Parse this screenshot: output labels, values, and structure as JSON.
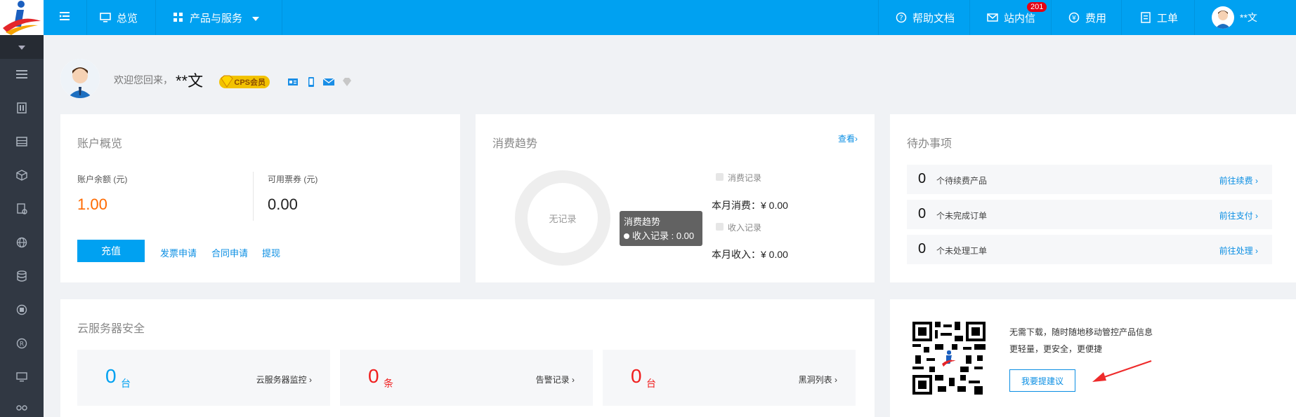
{
  "colors": {
    "brand_blue": "#00a1f1",
    "sidebar_bg": "#313843",
    "orange": "#ff6a00",
    "red": "#f01f1f",
    "link": "#0a8ee3"
  },
  "topbar": {
    "menu_toggle_icon": "menu-fold-icon",
    "overview": "总览",
    "products": "产品与服务",
    "help_docs": "帮助文档",
    "messages": "站内信",
    "messages_badge": "201",
    "fees": "费用",
    "tickets": "工单",
    "user_name": "**文"
  },
  "sidebar": {
    "icons": [
      "list-icon",
      "server-icon",
      "table-icon",
      "cube-icon",
      "document-icon",
      "globe-icon",
      "database-icon",
      "shield-icon",
      "registered-icon",
      "monitor-icon",
      "more-icon"
    ]
  },
  "welcome": {
    "greeting": "欢迎您回来，",
    "name": "**文",
    "member_badge": "CPS会员"
  },
  "account": {
    "title": "账户概览",
    "balance_label": "账户余额 (元)",
    "balance_value": "1.00",
    "voucher_label": "可用票券 (元)",
    "voucher_value": "0.00",
    "recharge": "充值",
    "invoice": "发票申请",
    "contract": "合同申请",
    "withdraw": "提现"
  },
  "trend": {
    "title": "消费趋势",
    "view": "查看›",
    "no_record": "无记录",
    "tooltip_title": "消费趋势",
    "tooltip_line": "收入记录 : 0.00",
    "legend_consume": "消费记录",
    "month_consume": "本月消费：¥ 0.00",
    "legend_income": "收入记录",
    "month_income": "本月收入：¥ 0.00"
  },
  "todo": {
    "title": "待办事项",
    "items": [
      {
        "count": "0",
        "text": "个待续费产品",
        "link": "前往续费 ›"
      },
      {
        "count": "0",
        "text": "个未完成订单",
        "link": "前往支付 ›"
      },
      {
        "count": "0",
        "text": "个未处理工单",
        "link": "前往处理 ›"
      }
    ]
  },
  "security": {
    "title": "云服务器安全",
    "boxes": [
      {
        "num": "0",
        "unit": "台",
        "link": "云服务器监控 ›"
      },
      {
        "num": "0",
        "unit": "条",
        "link": "告警记录 ›"
      },
      {
        "num": "0",
        "unit": "台",
        "link": "黑洞列表 ›"
      }
    ]
  },
  "mobile": {
    "line1": "无需下载，随时随地移动管控产品信息",
    "line2": "更轻量，更安全，更便捷",
    "suggest": "我要提建议"
  }
}
